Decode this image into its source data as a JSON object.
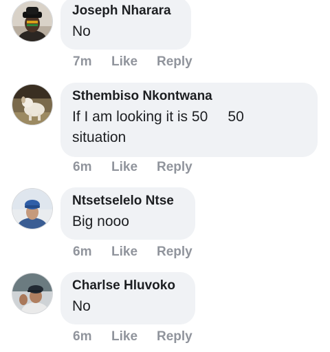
{
  "comments": [
    {
      "author": "Joseph Nharara",
      "text": "No",
      "time": "7m",
      "like_label": "Like",
      "reply_label": "Reply",
      "avatar_icon": "person-with-black-hat-avatar"
    },
    {
      "author": "Sthembiso Nkontwana",
      "text": "If I am looking it is 50     50\nsituation",
      "time": "6m",
      "like_label": "Like",
      "reply_label": "Reply",
      "avatar_icon": "dog-photo-avatar"
    },
    {
      "author": "Ntsetselelo Ntse",
      "text": "Big nooo",
      "time": "6m",
      "like_label": "Like",
      "reply_label": "Reply",
      "avatar_icon": "person-with-blue-cap-avatar"
    },
    {
      "author": "Charlse Hluvoko",
      "text": "No",
      "time": "6m",
      "like_label": "Like",
      "reply_label": "Reply",
      "avatar_icon": "person-with-dark-cap-avatar"
    }
  ],
  "colors": {
    "bubble": "#f0f2f5",
    "meta_text": "#90949c",
    "body_text": "#1c1e21"
  }
}
